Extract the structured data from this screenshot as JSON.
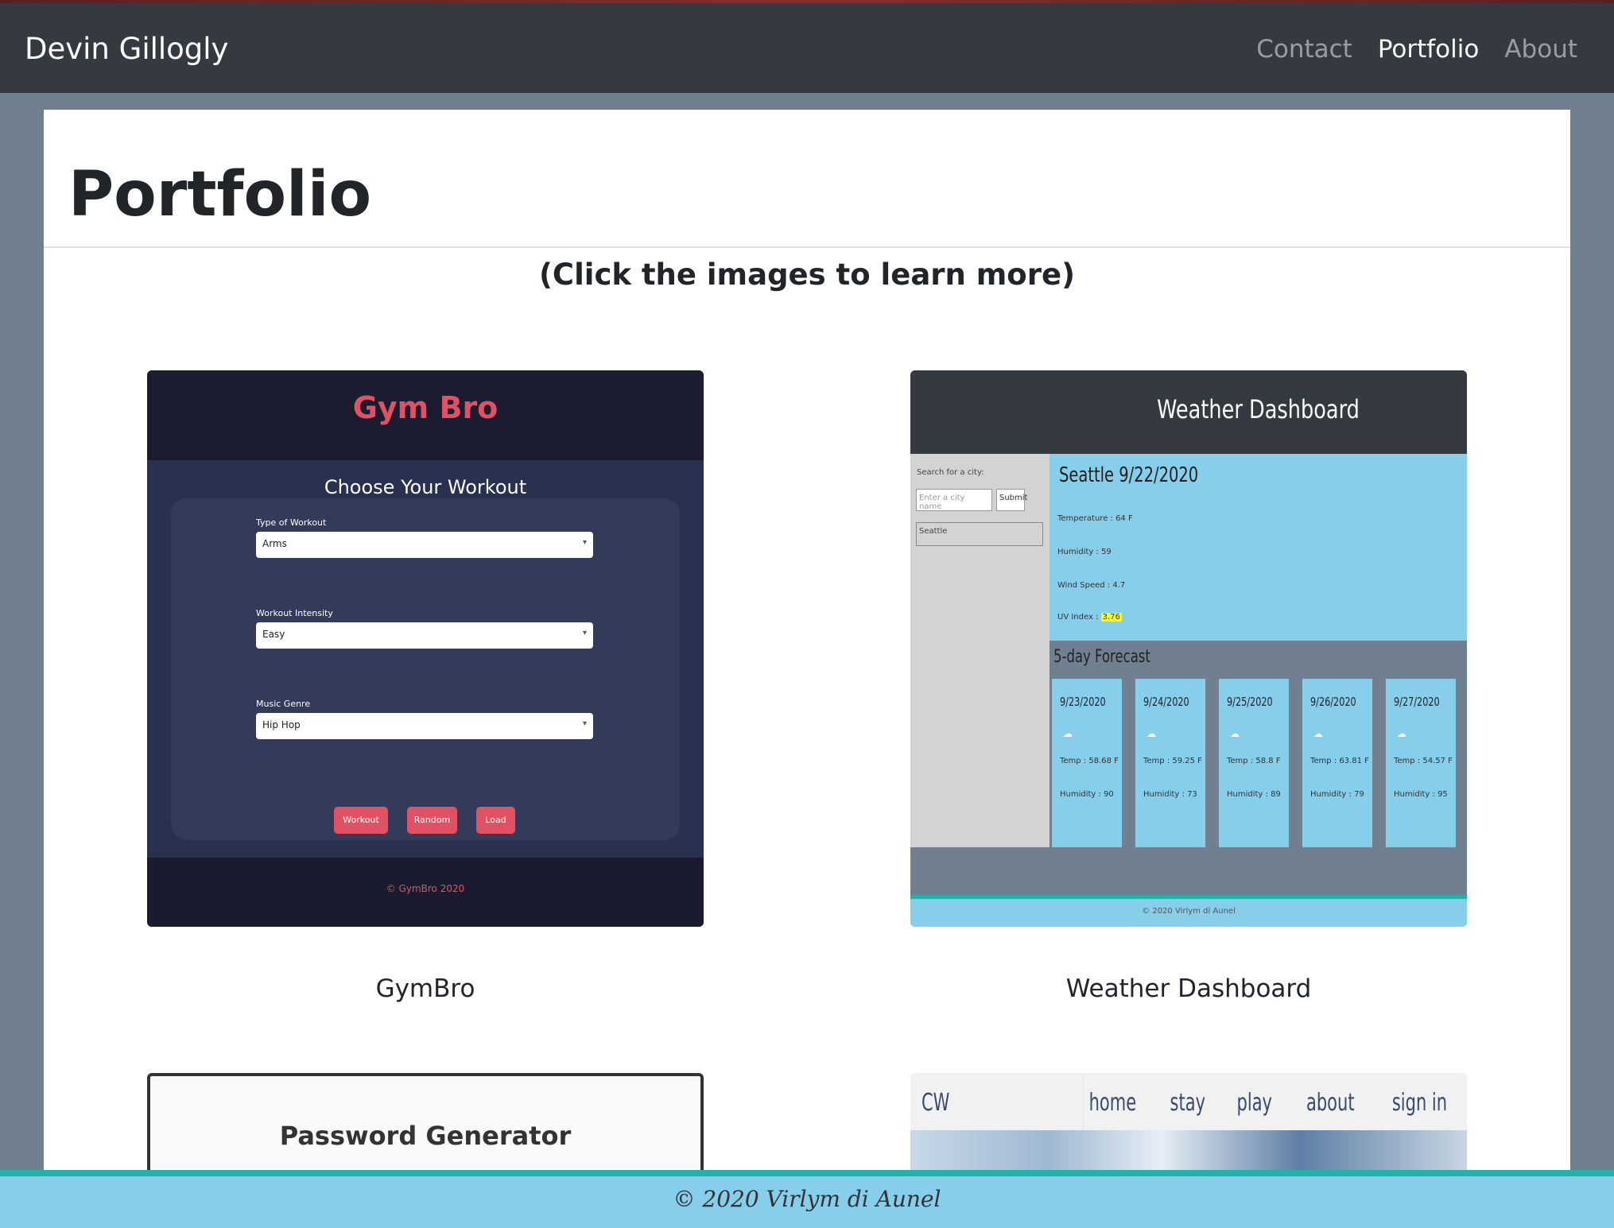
{
  "navbar": {
    "brand": "Devin Gillogly",
    "links": [
      {
        "label": "Contact",
        "active": false
      },
      {
        "label": "Portfolio",
        "active": true
      },
      {
        "label": "About",
        "active": false
      }
    ]
  },
  "page": {
    "title": "Portfolio",
    "subtitle": "(Click the images to learn more)"
  },
  "projects": [
    {
      "caption": "GymBro",
      "screenshot": {
        "logo": "Gym Bro",
        "heading": "Choose Your Workout",
        "fields": [
          {
            "label": "Type of Workout",
            "value": "Arms"
          },
          {
            "label": "Workout Intensity",
            "value": "Easy"
          },
          {
            "label": "Music Genre",
            "value": "Hip Hop"
          }
        ],
        "buttons": [
          "Workout",
          "Random",
          "Load"
        ],
        "footer": "© GymBro 2020"
      }
    },
    {
      "caption": "Weather Dashboard",
      "screenshot": {
        "title": "Weather Dashboard",
        "search_label": "Search for a city:",
        "search_placeholder": "Enter a city name",
        "submit_label": "Submit",
        "history_item": "Seattle",
        "city_date": "Seattle  9/22/2020",
        "temperature": "Temperature : 64 F",
        "humidity": "Humidity : 59",
        "wind": "Wind Speed : 4.7",
        "uv_label": "UV Index :",
        "uv_value": "3.76",
        "forecast_title": "5-day Forecast",
        "forecast": [
          {
            "date": "9/23/2020",
            "temp": "Temp : 58.68 F",
            "humidity": "Humidity : 90"
          },
          {
            "date": "9/24/2020",
            "temp": "Temp : 59.25 F",
            "humidity": "Humidity : 73"
          },
          {
            "date": "9/25/2020",
            "temp": "Temp : 58.8 F",
            "humidity": "Humidity : 89"
          },
          {
            "date": "9/26/2020",
            "temp": "Temp : 63.81 F",
            "humidity": "Humidity : 79"
          },
          {
            "date": "9/27/2020",
            "temp": "Temp : 54.57 F",
            "humidity": "Humidity : 95"
          }
        ],
        "footer": "© 2020 Virlym di Aunel"
      }
    },
    {
      "screenshot": {
        "title": "Password Generator"
      }
    },
    {
      "screenshot": {
        "logo": "CW",
        "links": [
          "home",
          "stay",
          "play",
          "about",
          "sign in"
        ]
      }
    }
  ],
  "footer": {
    "text": "© 2020 Virlym di Aunel"
  },
  "colors": {
    "navbar": "#343a40",
    "page_bg": "#708090",
    "footer_bg": "#87ceeb",
    "footer_accent": "#20b2aa",
    "gym_accent": "#e05263"
  }
}
